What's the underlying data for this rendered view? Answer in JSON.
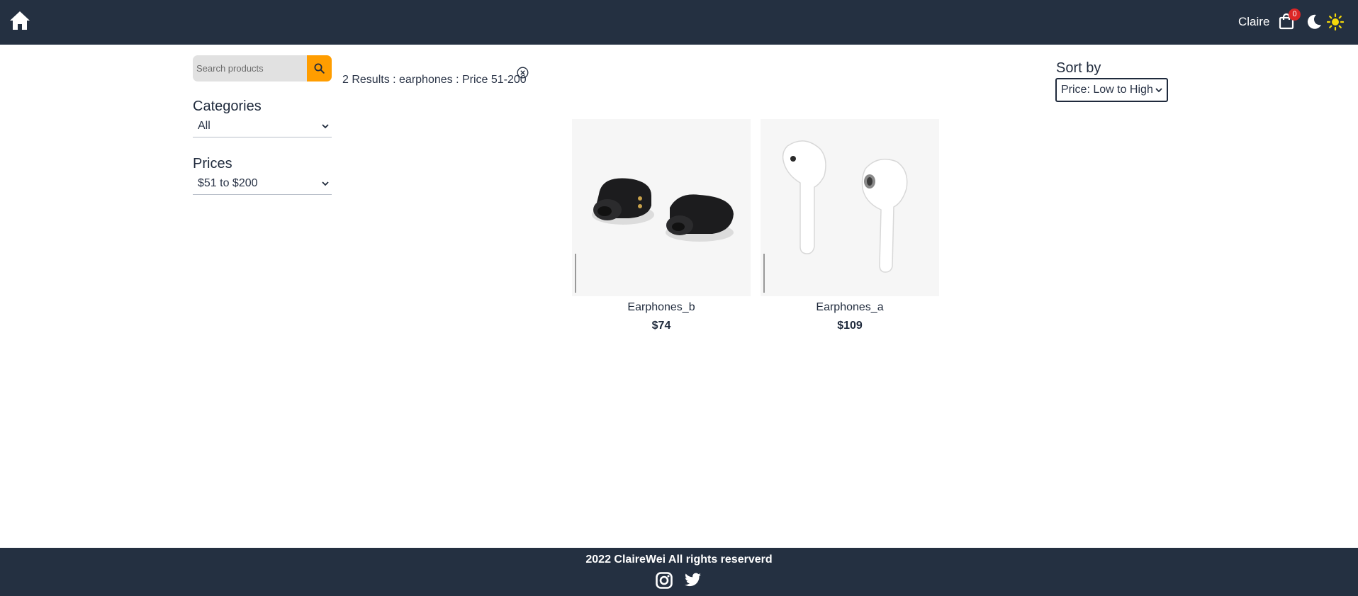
{
  "header": {
    "user_name": "Claire",
    "cart_count": "0",
    "icons": [
      "home-icon",
      "shopping-bag-icon",
      "moon-icon",
      "sun-icon"
    ]
  },
  "sidebar": {
    "search_placeholder": "Search products",
    "categories_title": "Categories",
    "categories_selected": "All",
    "prices_title": "Prices",
    "prices_selected": "$51 to $200"
  },
  "results": {
    "summary": "2 Results : earphones : Price 51-200"
  },
  "sort": {
    "label": "Sort by",
    "selected": "Price: Low to High"
  },
  "products": [
    {
      "name": "Earphones_b",
      "price": "$74"
    },
    {
      "name": "Earphones_a",
      "price": "$109"
    }
  ],
  "footer": {
    "text": "2022 ClaireWei All rights reserverd",
    "icons": [
      "instagram-icon",
      "twitter-icon"
    ]
  },
  "colors": {
    "navbar": "#243041",
    "accent": "#ff9d00",
    "badge": "#dc2626",
    "sun": "#f5d90a"
  }
}
